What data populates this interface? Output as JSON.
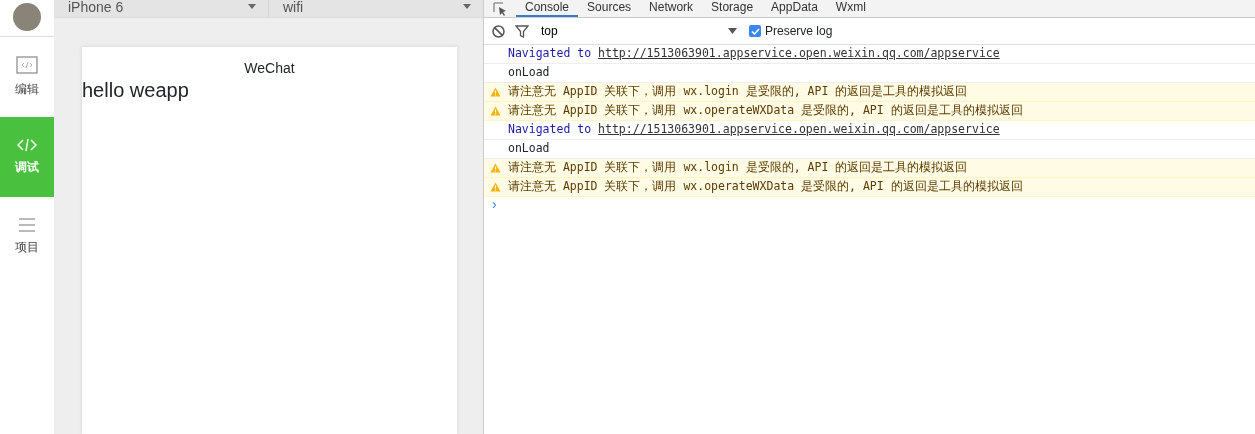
{
  "sidebar": {
    "items": [
      {
        "kind": "code-box",
        "label": "编辑",
        "selected": false
      },
      {
        "kind": "code",
        "label": "调试",
        "selected": true
      },
      {
        "kind": "menu",
        "label": "项目",
        "selected": false
      }
    ]
  },
  "simulator": {
    "device": "iPhone 6",
    "network": "wifi",
    "nav_title": "WeChat",
    "page_text": "hello weapp"
  },
  "devtools": {
    "tabs": [
      {
        "label": "Console",
        "selected": true
      },
      {
        "label": "Sources",
        "selected": false
      },
      {
        "label": "Network",
        "selected": false
      },
      {
        "label": "Storage",
        "selected": false
      },
      {
        "label": "AppData",
        "selected": false
      },
      {
        "label": "Wxml",
        "selected": false
      }
    ],
    "context": "top",
    "preserve_log": {
      "label": "Preserve log",
      "checked": true
    },
    "log": [
      {
        "kind": "nav",
        "text": "Navigated to",
        "link": "http://1513063901.appservice.open.weixin.qq.com/appservice"
      },
      {
        "kind": "log",
        "text": "onLoad"
      },
      {
        "kind": "warn",
        "text": "请注意无 AppID 关联下，调用 wx.login 是受限的, API 的返回是工具的模拟返回"
      },
      {
        "kind": "warn",
        "text": "请注意无 AppID 关联下，调用 wx.operateWXData 是受限的, API 的返回是工具的模拟返回"
      },
      {
        "kind": "nav",
        "text": "Navigated to",
        "link": "http://1513063901.appservice.open.weixin.qq.com/appservice"
      },
      {
        "kind": "log",
        "text": "onLoad"
      },
      {
        "kind": "warn",
        "text": "请注意无 AppID 关联下，调用 wx.login 是受限的, API 的返回是工具的模拟返回"
      },
      {
        "kind": "warn",
        "text": "请注意无 AppID 关联下，调用 wx.operateWXData 是受限的, API 的返回是工具的模拟返回"
      }
    ],
    "prompt": "›"
  }
}
